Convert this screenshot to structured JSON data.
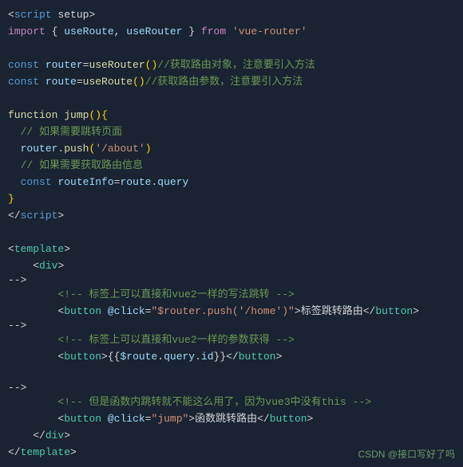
{
  "editor": {
    "background": "#1a2332",
    "lines": [
      {
        "id": "l1",
        "type": "code"
      },
      {
        "id": "l2",
        "type": "code"
      },
      {
        "id": "l3",
        "type": "empty"
      },
      {
        "id": "l4",
        "type": "code"
      },
      {
        "id": "l5",
        "type": "code"
      },
      {
        "id": "l6",
        "type": "empty"
      },
      {
        "id": "l7",
        "type": "code"
      },
      {
        "id": "l8",
        "type": "code"
      },
      {
        "id": "l9",
        "type": "code"
      },
      {
        "id": "l10",
        "type": "code"
      },
      {
        "id": "l11",
        "type": "code"
      },
      {
        "id": "l12",
        "type": "code"
      },
      {
        "id": "l13",
        "type": "code"
      },
      {
        "id": "l14",
        "type": "empty"
      },
      {
        "id": "l15",
        "type": "code"
      },
      {
        "id": "l16",
        "type": "empty"
      },
      {
        "id": "l17",
        "type": "code"
      },
      {
        "id": "l18",
        "type": "code"
      },
      {
        "id": "l19",
        "type": "code"
      },
      {
        "id": "l20",
        "type": "code"
      },
      {
        "id": "l21",
        "type": "code"
      },
      {
        "id": "l22",
        "type": "code"
      },
      {
        "id": "l23",
        "type": "empty"
      },
      {
        "id": "l24",
        "type": "code"
      },
      {
        "id": "l25",
        "type": "code"
      },
      {
        "id": "l26",
        "type": "code"
      }
    ]
  },
  "watermark": {
    "text": "CSDN @接口写好了吗"
  }
}
